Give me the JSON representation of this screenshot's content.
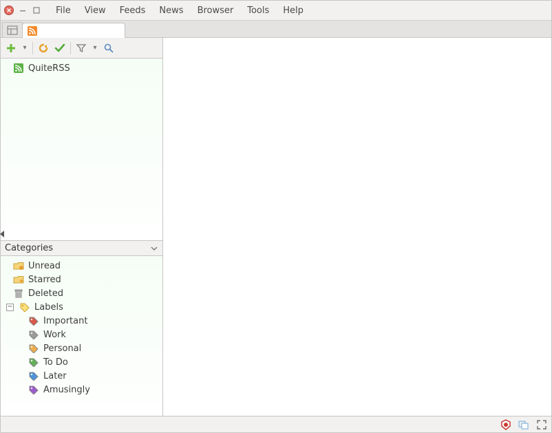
{
  "menu": {
    "items": [
      "File",
      "View",
      "Feeds",
      "News",
      "Browser",
      "Tools",
      "Help"
    ]
  },
  "sidebar": {
    "feeds": [
      {
        "label": "QuiteRSS"
      }
    ],
    "categories_title": "Categories",
    "categories": [
      {
        "label": "Unread"
      },
      {
        "label": "Starred"
      },
      {
        "label": "Deleted"
      }
    ],
    "labels_title": "Labels",
    "labels": [
      {
        "label": "Important",
        "color": "#d43b2a"
      },
      {
        "label": "Work",
        "color": "#8a8a8a"
      },
      {
        "label": "Personal",
        "color": "#e79f2e"
      },
      {
        "label": "To Do",
        "color": "#49a23a"
      },
      {
        "label": "Later",
        "color": "#2f7fd1"
      },
      {
        "label": "Amusingly",
        "color": "#8a3fc2"
      }
    ]
  }
}
